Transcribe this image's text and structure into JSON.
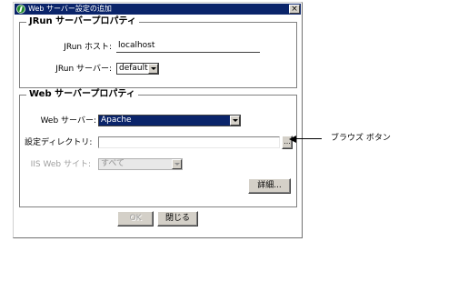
{
  "window": {
    "title": "Web サーバー設定の追加",
    "close_label": "×"
  },
  "jrun_group": {
    "legend": "JRun サーバープロパティ",
    "host_label": "JRun ホスト:",
    "host_value": "localhost",
    "server_label": "JRun サーバー:",
    "server_value": "default"
  },
  "web_group": {
    "legend": "Web サーバープロパティ",
    "webserver_label": "Web サーバー:",
    "webserver_value": "Apache",
    "config_dir_label": "設定ディレクトリ:",
    "config_dir_value": "",
    "browse_label": "...",
    "iis_label": "IIS Web サイト:",
    "iis_value": "すべて",
    "details_label": "詳細..."
  },
  "buttons": {
    "ok_label": "OK",
    "close_label": "閉じる"
  },
  "callout": {
    "label": "ブラウズ ボタン"
  }
}
